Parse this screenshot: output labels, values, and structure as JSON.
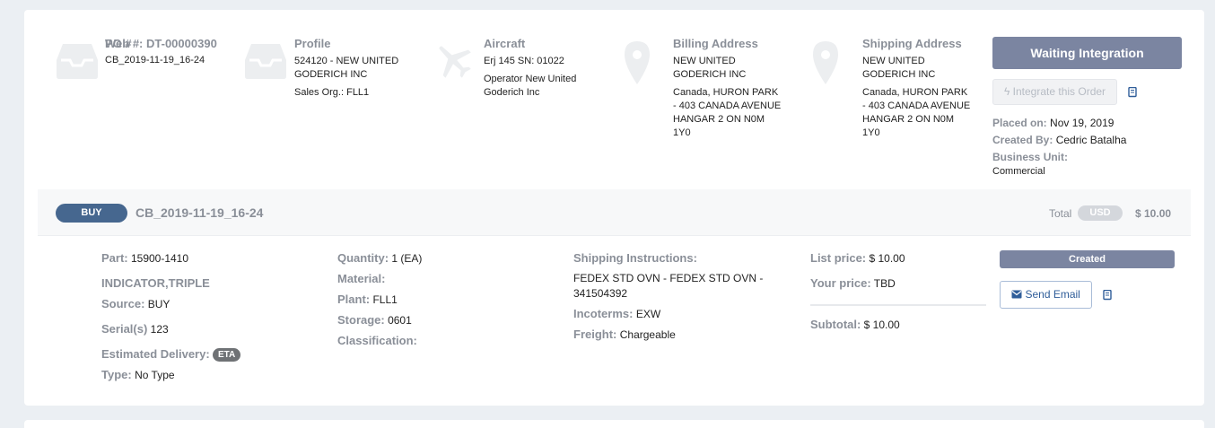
{
  "header": {
    "web": {
      "label": "Web #:",
      "value": "DT-00000390",
      "po_label": "PO #",
      "po_value": "CB_2019-11-19_16-24"
    },
    "profile": {
      "title": "Profile",
      "line1": "524120 - NEW UNITED",
      "line2": "GODERICH INC",
      "sales_label": "Sales Org.:",
      "sales_value": "FLL1"
    },
    "aircraft": {
      "title": "Aircraft",
      "line1": "Erj 145 SN: 01022",
      "line2": "Operator New United",
      "line3": "Goderich Inc"
    },
    "billing": {
      "title": "Billing Address",
      "lines": [
        "NEW UNITED",
        "GODERICH INC",
        "Canada, HURON PARK",
        "- 403 CANADA AVENUE",
        "HANGAR 2 ON N0M",
        "1Y0"
      ]
    },
    "shipping": {
      "title": "Shipping Address",
      "lines": [
        "NEW UNITED",
        "GODERICH INC",
        "Canada, HURON PARK",
        "- 403 CANADA AVENUE",
        "HANGAR 2 ON N0M",
        "1Y0"
      ]
    }
  },
  "actions": {
    "status_button": "Waiting Integration",
    "integrate_button": "Integrate this Order",
    "placed_label": "Placed on:",
    "placed_value": "Nov 19, 2019",
    "created_by_label": "Created By:",
    "created_by_value": "Cedric Batalha",
    "business_unit_label": "Business Unit:",
    "business_unit_value": "Commercial"
  },
  "order": {
    "type_badge": "BUY",
    "reference": "CB_2019-11-19_16-24",
    "total_label": "Total",
    "currency": "USD",
    "total_amount": "$ 10.00"
  },
  "line": {
    "part_label": "Part:",
    "part_value": "15900-1410",
    "description": "INDICATOR,TRIPLE",
    "source_label": "Source:",
    "source_value": "BUY",
    "serials_label": "Serial(s)",
    "serials_value": "123",
    "eta_label": "Estimated Delivery:",
    "eta_badge": "ETA",
    "type_label": "Type:",
    "type_value": "No Type",
    "quantity_label": "Quantity:",
    "quantity_value": "1 (EA)",
    "material_label": "Material:",
    "plant_label": "Plant:",
    "plant_value": "FLL1",
    "storage_label": "Storage:",
    "storage_value": "0601",
    "classification_label": "Classification:",
    "ship_instr_label": "Shipping Instructions:",
    "ship_instr_line1": "FEDEX STD OVN - FEDEX STD OVN -",
    "ship_instr_line2": "341504392",
    "incoterms_label": "Incoterms:",
    "incoterms_value": "EXW",
    "freight_label": "Freight:",
    "freight_value": "Chargeable",
    "list_price_label": "List price:",
    "list_price_value": "$ 10.00",
    "your_price_label": "Your price:",
    "your_price_value": "TBD",
    "subtotal_label": "Subtotal:",
    "subtotal_value": "$ 10.00",
    "status_badge": "Created",
    "send_email": "Send Email"
  },
  "icons": {
    "inbox": "inbox-icon",
    "plane": "plane-icon",
    "pin": "map-pin-icon",
    "book": "book-icon",
    "bolt": "bolt-icon",
    "envelope": "envelope-icon"
  },
  "colors": {
    "accent": "#7b85a1",
    "buy_badge": "#46678f",
    "link": "#2f5d99",
    "label": "#8a8f98"
  }
}
